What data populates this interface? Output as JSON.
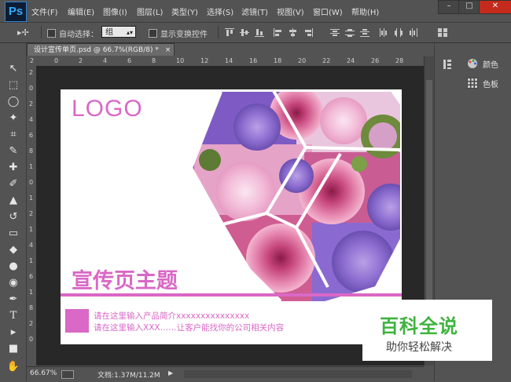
{
  "app": {
    "logo": "Ps"
  },
  "menu": [
    "文件(F)",
    "编辑(E)",
    "图像(I)",
    "图层(L)",
    "类型(Y)",
    "选择(S)",
    "滤镜(T)",
    "视图(V)",
    "窗口(W)",
    "帮助(H)"
  ],
  "window_controls": {
    "minimize": "–",
    "maximize": "□",
    "close": "✕"
  },
  "options_bar": {
    "move_icon": "▸✢",
    "auto_select_label": "自动选择：",
    "auto_select_value": "组",
    "show_transform_label": "显示变换控件"
  },
  "document": {
    "tab_title": "设计宣传单页.psd @ 66.7%(RGB/8) *",
    "tab_close": "×",
    "zoom": "66.67%",
    "doc_info": "文档:1.37M/11.2M"
  },
  "ruler_top_labels": [
    "2",
    "0",
    "2",
    "4",
    "6",
    "8",
    "10",
    "12",
    "14",
    "16",
    "18",
    "20",
    "22",
    "24",
    "26",
    "28"
  ],
  "ruler_left_labels": [
    "2",
    "0",
    "2",
    "4",
    "6",
    "8",
    "1",
    "0",
    "1",
    "2",
    "1",
    "4",
    "1",
    "6",
    "1",
    "8",
    "2",
    "0"
  ],
  "tools": [
    "move-tool",
    "marquee-tool",
    "lasso-tool",
    "magic-wand-tool",
    "crop-tool",
    "eyedropper-tool",
    "healing-brush-tool",
    "brush-tool",
    "clone-stamp-tool",
    "history-brush-tool",
    "eraser-tool",
    "paint-bucket-tool",
    "blur-tool",
    "dodge-tool",
    "pen-tool",
    "type-tool",
    "path-selection-tool",
    "rectangle-tool",
    "hand-tool"
  ],
  "tool_glyphs": [
    "↖",
    "⬚",
    "◯",
    "✦",
    "⌗",
    "✎",
    "✚",
    "✐",
    "▲",
    "↺",
    "▭",
    "◆",
    "●",
    "◉",
    "✒",
    "T",
    "▸",
    "■",
    "✋"
  ],
  "panels": [
    {
      "label": "颜色",
      "icon": "palette-icon"
    },
    {
      "label": "色板",
      "icon": "swatches-icon"
    }
  ],
  "flyer": {
    "logo": "LOGO",
    "title": "宣传页主题",
    "line1": "请在这里输入产品简介xxxxxxxxxxxxxxx",
    "line2": "请在这里输入XXX……让客户能找你的公司相关内容",
    "accent_color": "#d968c6"
  },
  "watermark": {
    "main": "百科全说",
    "sub": "助你轻松解决"
  }
}
